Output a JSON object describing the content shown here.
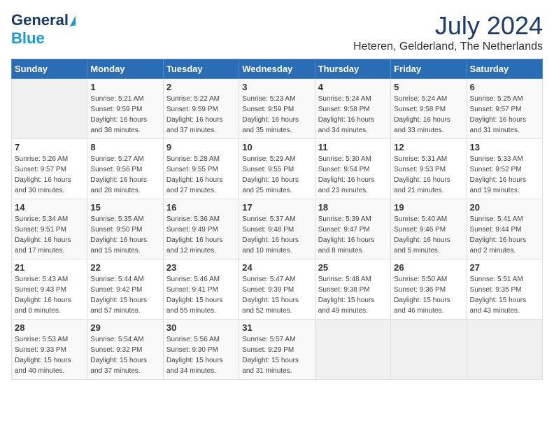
{
  "header": {
    "logo_general": "General",
    "logo_blue": "Blue",
    "month_year": "July 2024",
    "location": "Heteren, Gelderland, The Netherlands"
  },
  "days_of_week": [
    "Sunday",
    "Monday",
    "Tuesday",
    "Wednesday",
    "Thursday",
    "Friday",
    "Saturday"
  ],
  "weeks": [
    [
      {
        "day": "",
        "info": ""
      },
      {
        "day": "1",
        "info": "Sunrise: 5:21 AM\nSunset: 9:59 PM\nDaylight: 16 hours\nand 38 minutes."
      },
      {
        "day": "2",
        "info": "Sunrise: 5:22 AM\nSunset: 9:59 PM\nDaylight: 16 hours\nand 37 minutes."
      },
      {
        "day": "3",
        "info": "Sunrise: 5:23 AM\nSunset: 9:59 PM\nDaylight: 16 hours\nand 35 minutes."
      },
      {
        "day": "4",
        "info": "Sunrise: 5:24 AM\nSunset: 9:58 PM\nDaylight: 16 hours\nand 34 minutes."
      },
      {
        "day": "5",
        "info": "Sunrise: 5:24 AM\nSunset: 9:58 PM\nDaylight: 16 hours\nand 33 minutes."
      },
      {
        "day": "6",
        "info": "Sunrise: 5:25 AM\nSunset: 9:57 PM\nDaylight: 16 hours\nand 31 minutes."
      }
    ],
    [
      {
        "day": "7",
        "info": "Sunrise: 5:26 AM\nSunset: 9:57 PM\nDaylight: 16 hours\nand 30 minutes."
      },
      {
        "day": "8",
        "info": "Sunrise: 5:27 AM\nSunset: 9:56 PM\nDaylight: 16 hours\nand 28 minutes."
      },
      {
        "day": "9",
        "info": "Sunrise: 5:28 AM\nSunset: 9:55 PM\nDaylight: 16 hours\nand 27 minutes."
      },
      {
        "day": "10",
        "info": "Sunrise: 5:29 AM\nSunset: 9:55 PM\nDaylight: 16 hours\nand 25 minutes."
      },
      {
        "day": "11",
        "info": "Sunrise: 5:30 AM\nSunset: 9:54 PM\nDaylight: 16 hours\nand 23 minutes."
      },
      {
        "day": "12",
        "info": "Sunrise: 5:31 AM\nSunset: 9:53 PM\nDaylight: 16 hours\nand 21 minutes."
      },
      {
        "day": "13",
        "info": "Sunrise: 5:33 AM\nSunset: 9:52 PM\nDaylight: 16 hours\nand 19 minutes."
      }
    ],
    [
      {
        "day": "14",
        "info": "Sunrise: 5:34 AM\nSunset: 9:51 PM\nDaylight: 16 hours\nand 17 minutes."
      },
      {
        "day": "15",
        "info": "Sunrise: 5:35 AM\nSunset: 9:50 PM\nDaylight: 16 hours\nand 15 minutes."
      },
      {
        "day": "16",
        "info": "Sunrise: 5:36 AM\nSunset: 9:49 PM\nDaylight: 16 hours\nand 12 minutes."
      },
      {
        "day": "17",
        "info": "Sunrise: 5:37 AM\nSunset: 9:48 PM\nDaylight: 16 hours\nand 10 minutes."
      },
      {
        "day": "18",
        "info": "Sunrise: 5:39 AM\nSunset: 9:47 PM\nDaylight: 16 hours\nand 8 minutes."
      },
      {
        "day": "19",
        "info": "Sunrise: 5:40 AM\nSunset: 9:46 PM\nDaylight: 16 hours\nand 5 minutes."
      },
      {
        "day": "20",
        "info": "Sunrise: 5:41 AM\nSunset: 9:44 PM\nDaylight: 16 hours\nand 2 minutes."
      }
    ],
    [
      {
        "day": "21",
        "info": "Sunrise: 5:43 AM\nSunset: 9:43 PM\nDaylight: 16 hours\nand 0 minutes."
      },
      {
        "day": "22",
        "info": "Sunrise: 5:44 AM\nSunset: 9:42 PM\nDaylight: 15 hours\nand 57 minutes."
      },
      {
        "day": "23",
        "info": "Sunrise: 5:46 AM\nSunset: 9:41 PM\nDaylight: 15 hours\nand 55 minutes."
      },
      {
        "day": "24",
        "info": "Sunrise: 5:47 AM\nSunset: 9:39 PM\nDaylight: 15 hours\nand 52 minutes."
      },
      {
        "day": "25",
        "info": "Sunrise: 5:48 AM\nSunset: 9:38 PM\nDaylight: 15 hours\nand 49 minutes."
      },
      {
        "day": "26",
        "info": "Sunrise: 5:50 AM\nSunset: 9:36 PM\nDaylight: 15 hours\nand 46 minutes."
      },
      {
        "day": "27",
        "info": "Sunrise: 5:51 AM\nSunset: 9:35 PM\nDaylight: 15 hours\nand 43 minutes."
      }
    ],
    [
      {
        "day": "28",
        "info": "Sunrise: 5:53 AM\nSunset: 9:33 PM\nDaylight: 15 hours\nand 40 minutes."
      },
      {
        "day": "29",
        "info": "Sunrise: 5:54 AM\nSunset: 9:32 PM\nDaylight: 15 hours\nand 37 minutes."
      },
      {
        "day": "30",
        "info": "Sunrise: 5:56 AM\nSunset: 9:30 PM\nDaylight: 15 hours\nand 34 minutes."
      },
      {
        "day": "31",
        "info": "Sunrise: 5:57 AM\nSunset: 9:29 PM\nDaylight: 15 hours\nand 31 minutes."
      },
      {
        "day": "",
        "info": ""
      },
      {
        "day": "",
        "info": ""
      },
      {
        "day": "",
        "info": ""
      }
    ]
  ]
}
